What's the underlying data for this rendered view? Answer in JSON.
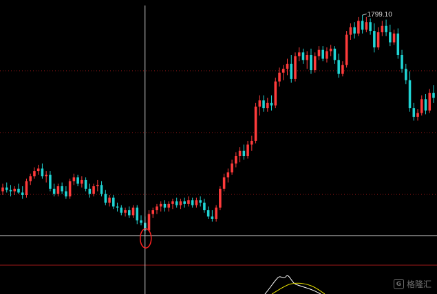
{
  "chart_data": {
    "type": "candlestick",
    "title": "",
    "xlabel": "",
    "ylabel": "",
    "ylim": [
      1440,
      1810
    ],
    "grid": true,
    "max_annotation": "1799.10",
    "colors": {
      "up": "#ff3b3b",
      "down": "#20d4d4",
      "background": "#000000",
      "grid": "#a01818",
      "crosshair": "#cfcfcf",
      "marker": "#ff2020",
      "indicator_white": "#ffffff",
      "indicator_yellow": "#e8e000"
    },
    "ohlc": [
      [
        1520,
        1532,
        1514,
        1526
      ],
      [
        1526,
        1534,
        1518,
        1522
      ],
      [
        1522,
        1530,
        1512,
        1520
      ],
      [
        1520,
        1528,
        1514,
        1524
      ],
      [
        1524,
        1532,
        1516,
        1518
      ],
      [
        1518,
        1528,
        1508,
        1514
      ],
      [
        1514,
        1540,
        1510,
        1536
      ],
      [
        1536,
        1548,
        1530,
        1544
      ],
      [
        1544,
        1558,
        1540,
        1552
      ],
      [
        1552,
        1562,
        1546,
        1556
      ],
      [
        1556,
        1564,
        1540,
        1544
      ],
      [
        1544,
        1552,
        1534,
        1546
      ],
      [
        1546,
        1552,
        1520,
        1524
      ],
      [
        1524,
        1532,
        1512,
        1516
      ],
      [
        1516,
        1532,
        1512,
        1528
      ],
      [
        1528,
        1534,
        1516,
        1520
      ],
      [
        1520,
        1528,
        1508,
        1512
      ],
      [
        1512,
        1540,
        1508,
        1536
      ],
      [
        1536,
        1548,
        1530,
        1542
      ],
      [
        1542,
        1546,
        1528,
        1532
      ],
      [
        1532,
        1544,
        1526,
        1538
      ],
      [
        1538,
        1542,
        1520,
        1524
      ],
      [
        1524,
        1532,
        1510,
        1516
      ],
      [
        1516,
        1532,
        1512,
        1528
      ],
      [
        1528,
        1538,
        1520,
        1530
      ],
      [
        1530,
        1536,
        1512,
        1516
      ],
      [
        1516,
        1522,
        1498,
        1502
      ],
      [
        1502,
        1514,
        1496,
        1510
      ],
      [
        1510,
        1514,
        1492,
        1496
      ],
      [
        1496,
        1502,
        1488,
        1494
      ],
      [
        1494,
        1498,
        1482,
        1486
      ],
      [
        1486,
        1494,
        1480,
        1490
      ],
      [
        1490,
        1496,
        1478,
        1482
      ],
      [
        1482,
        1498,
        1478,
        1494
      ],
      [
        1494,
        1498,
        1468,
        1474
      ],
      [
        1474,
        1482,
        1466,
        1470
      ],
      [
        1470,
        1480,
        1452,
        1458
      ],
      [
        1458,
        1490,
        1456,
        1484
      ],
      [
        1484,
        1494,
        1478,
        1490
      ],
      [
        1490,
        1500,
        1484,
        1496
      ],
      [
        1496,
        1504,
        1488,
        1500
      ],
      [
        1500,
        1506,
        1488,
        1494
      ],
      [
        1494,
        1504,
        1488,
        1500
      ],
      [
        1500,
        1508,
        1492,
        1504
      ],
      [
        1504,
        1510,
        1494,
        1498
      ],
      [
        1498,
        1508,
        1492,
        1504
      ],
      [
        1504,
        1510,
        1494,
        1500
      ],
      [
        1500,
        1512,
        1496,
        1506
      ],
      [
        1506,
        1510,
        1494,
        1498
      ],
      [
        1498,
        1510,
        1494,
        1506
      ],
      [
        1506,
        1512,
        1496,
        1502
      ],
      [
        1502,
        1508,
        1486,
        1490
      ],
      [
        1490,
        1496,
        1476,
        1480
      ],
      [
        1480,
        1490,
        1472,
        1476
      ],
      [
        1476,
        1498,
        1472,
        1494
      ],
      [
        1494,
        1528,
        1490,
        1524
      ],
      [
        1524,
        1548,
        1520,
        1542
      ],
      [
        1542,
        1556,
        1534,
        1550
      ],
      [
        1550,
        1570,
        1546,
        1564
      ],
      [
        1564,
        1582,
        1558,
        1576
      ],
      [
        1576,
        1590,
        1566,
        1584
      ],
      [
        1584,
        1594,
        1570,
        1576
      ],
      [
        1576,
        1600,
        1572,
        1594
      ],
      [
        1594,
        1608,
        1584,
        1600
      ],
      [
        1600,
        1660,
        1596,
        1654
      ],
      [
        1654,
        1672,
        1640,
        1664
      ],
      [
        1664,
        1672,
        1646,
        1652
      ],
      [
        1652,
        1668,
        1646,
        1660
      ],
      [
        1660,
        1672,
        1648,
        1656
      ],
      [
        1656,
        1700,
        1652,
        1694
      ],
      [
        1694,
        1716,
        1686,
        1708
      ],
      [
        1708,
        1720,
        1696,
        1714
      ],
      [
        1714,
        1730,
        1704,
        1722
      ],
      [
        1722,
        1736,
        1692,
        1698
      ],
      [
        1698,
        1740,
        1694,
        1734
      ],
      [
        1734,
        1748,
        1726,
        1740
      ],
      [
        1740,
        1746,
        1722,
        1728
      ],
      [
        1728,
        1742,
        1714,
        1736
      ],
      [
        1736,
        1746,
        1706,
        1712
      ],
      [
        1712,
        1740,
        1708,
        1734
      ],
      [
        1734,
        1750,
        1728,
        1744
      ],
      [
        1744,
        1750,
        1726,
        1730
      ],
      [
        1730,
        1748,
        1724,
        1742
      ],
      [
        1742,
        1752,
        1734,
        1746
      ],
      [
        1746,
        1750,
        1722,
        1728
      ],
      [
        1728,
        1738,
        1700,
        1706
      ],
      [
        1706,
        1726,
        1702,
        1720
      ],
      [
        1720,
        1774,
        1716,
        1768
      ],
      [
        1768,
        1786,
        1760,
        1780
      ],
      [
        1780,
        1788,
        1762,
        1770
      ],
      [
        1770,
        1796,
        1766,
        1790
      ],
      [
        1790,
        1799,
        1770,
        1776
      ],
      [
        1776,
        1796,
        1772,
        1788
      ],
      [
        1788,
        1794,
        1768,
        1774
      ],
      [
        1774,
        1786,
        1740,
        1748
      ],
      [
        1748,
        1780,
        1744,
        1772
      ],
      [
        1772,
        1790,
        1766,
        1782
      ],
      [
        1782,
        1792,
        1766,
        1772
      ],
      [
        1772,
        1784,
        1750,
        1756
      ],
      [
        1756,
        1776,
        1752,
        1770
      ],
      [
        1770,
        1778,
        1730,
        1736
      ],
      [
        1736,
        1744,
        1708,
        1714
      ],
      [
        1714,
        1722,
        1690,
        1696
      ],
      [
        1696,
        1710,
        1646,
        1652
      ],
      [
        1652,
        1660,
        1632,
        1638
      ],
      [
        1638,
        1650,
        1632,
        1644
      ],
      [
        1644,
        1672,
        1640,
        1666
      ],
      [
        1666,
        1674,
        1642,
        1648
      ],
      [
        1648,
        1682,
        1644,
        1676
      ],
      [
        1676,
        1688,
        1660,
        1668
      ]
    ]
  },
  "watermark": {
    "logo_glyph": "G",
    "text": "格隆汇"
  }
}
